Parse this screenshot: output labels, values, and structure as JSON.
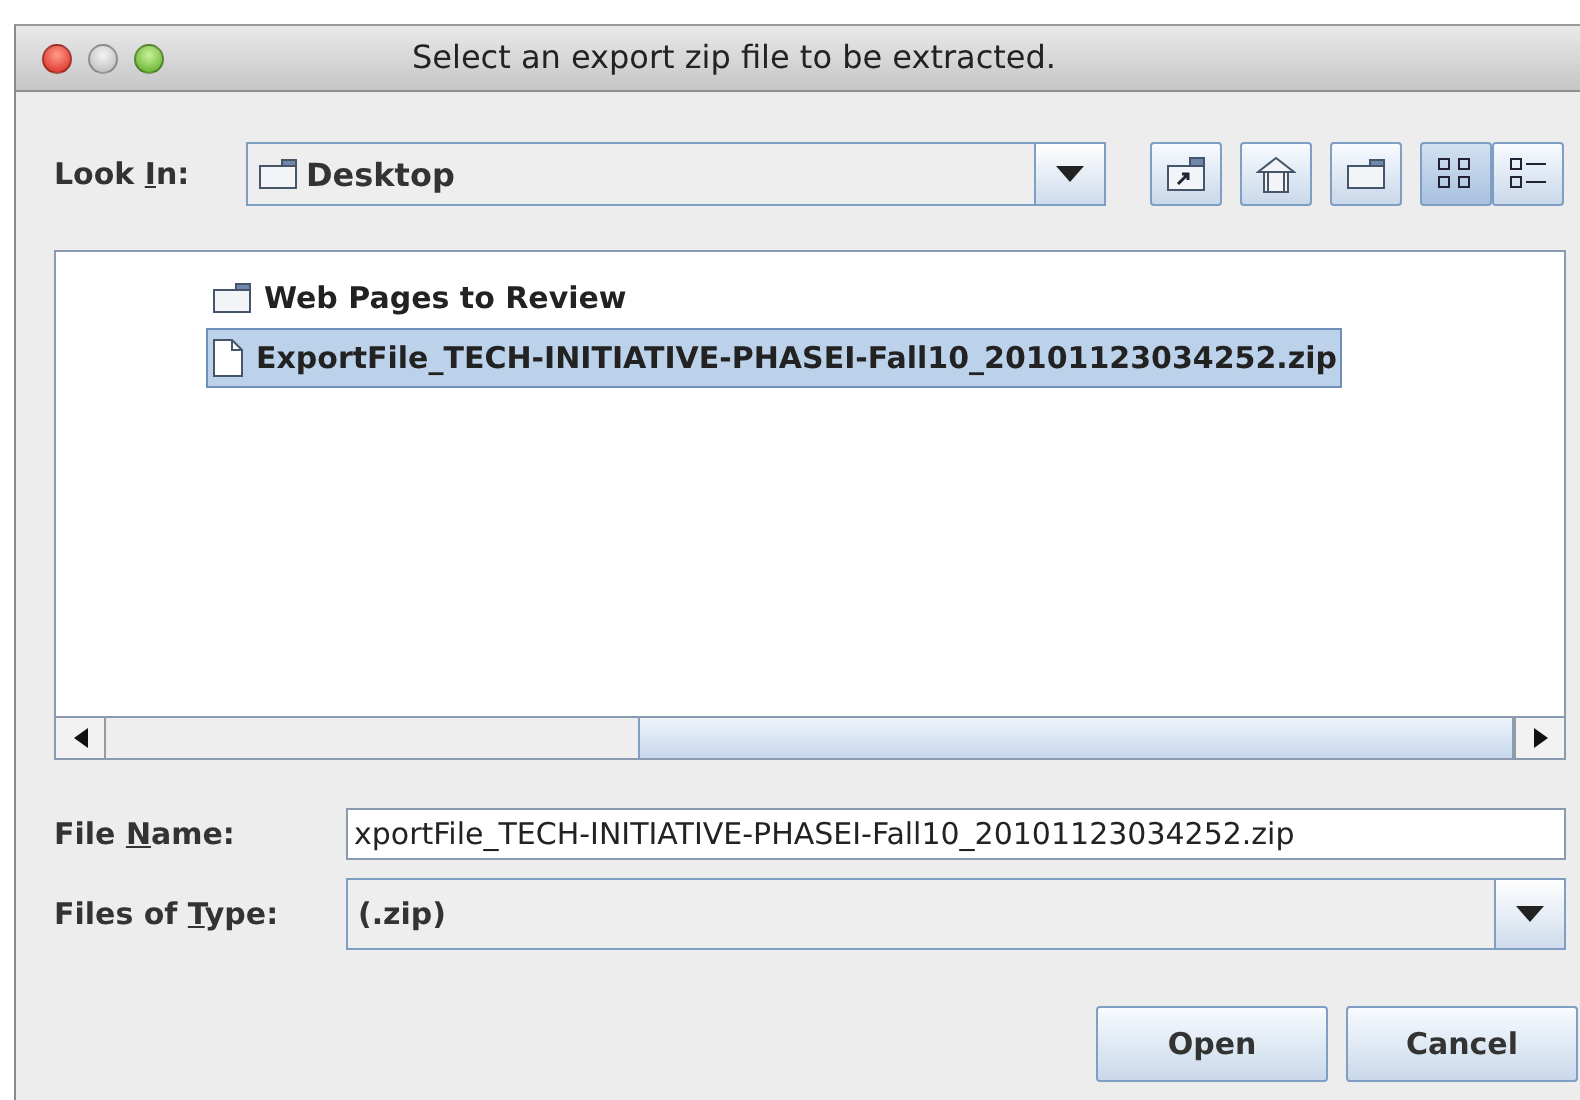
{
  "window": {
    "title": "Select an export zip file to be extracted."
  },
  "look_in": {
    "label": {
      "before": "Look ",
      "key": "I",
      "after": "n:"
    },
    "value": "Desktop"
  },
  "toolbar": [
    {
      "kind": "up-folder",
      "selected": false
    },
    {
      "kind": "home",
      "selected": false
    },
    {
      "kind": "new-folder",
      "selected": false
    },
    {
      "kind": "list",
      "selected": true
    },
    {
      "kind": "details",
      "selected": false
    }
  ],
  "files": [
    {
      "kind": "folder",
      "name": "Web Pages to Review",
      "selected": false
    },
    {
      "kind": "file",
      "name": "ExportFile_TECH-INITIATIVE-PHASEI-Fall10_20101123034252.zip",
      "selected": true
    }
  ],
  "file_name": {
    "label": {
      "before": "File ",
      "key": "N",
      "after": "ame:"
    },
    "value": "xportFile_TECH-INITIATIVE-PHASEI-Fall10_20101123034252.zip"
  },
  "file_type": {
    "label": {
      "before": "Files of ",
      "key": "T",
      "after": "ype:"
    },
    "value": "(.zip)"
  },
  "buttons": [
    "Open",
    "Cancel"
  ]
}
